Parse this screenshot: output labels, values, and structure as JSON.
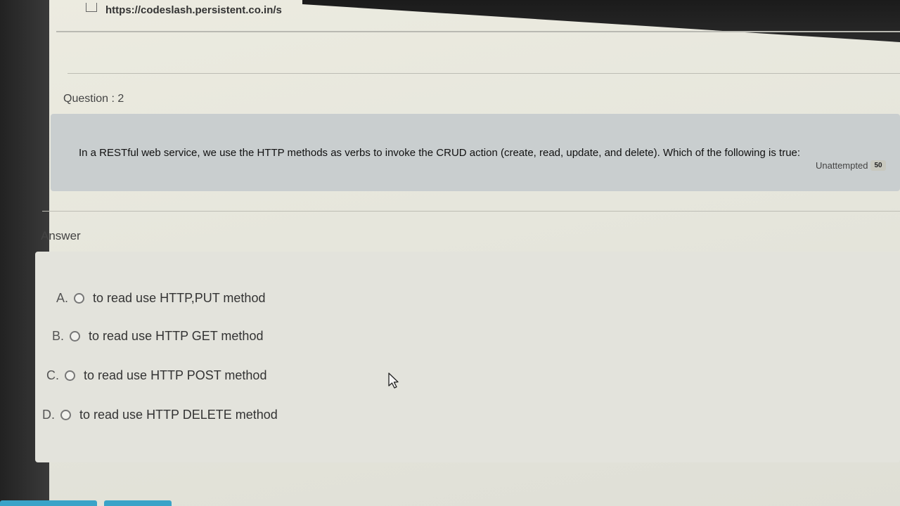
{
  "browser": {
    "url": "https://codeslash.persistent.co.in/s"
  },
  "question": {
    "label": "Question : 2",
    "text": "In a RESTful web service, we use the HTTP methods as verbs to invoke the CRUD action (create, read, update, and delete). Which of the following is true:",
    "status": "Unattempted",
    "score": "50"
  },
  "answer": {
    "label": "Answer",
    "options": [
      {
        "letter": "A.",
        "text": "to read use HTTP,PUT method"
      },
      {
        "letter": "B.",
        "text": "to read use HTTP GET method"
      },
      {
        "letter": "C.",
        "text": "to read use HTTP POST method"
      },
      {
        "letter": "D.",
        "text": "to read use HTTP DELETE method"
      }
    ]
  },
  "icons": {
    "cursor": "mouse-pointer-icon",
    "url": "page-icon",
    "radio": "radio-unselected-icon"
  },
  "colors": {
    "question_box": "#c9cecf",
    "answer_box": "#e3e3dc",
    "bottom_buttons": "#3aa3c8"
  }
}
